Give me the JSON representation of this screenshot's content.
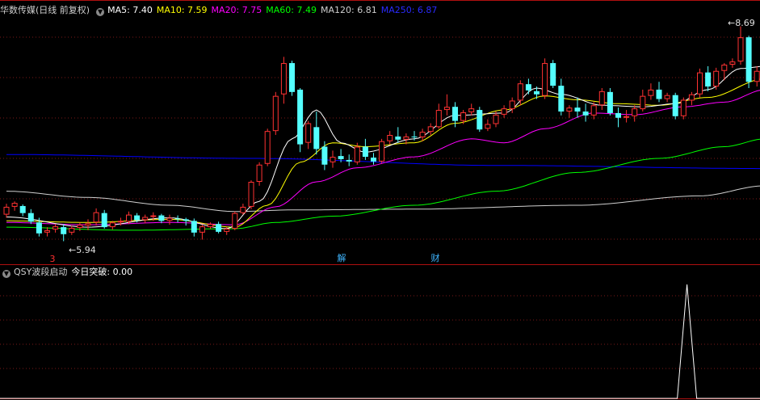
{
  "main_panel": {
    "title": "华数传媒(日线 前复权)",
    "indicators": [
      {
        "label": "MA5:",
        "value": "7.40",
        "color": "#ffffff"
      },
      {
        "label": "MA10:",
        "value": "7.59",
        "color": "#ffff00"
      },
      {
        "label": "MA20:",
        "value": "7.75",
        "color": "#ff00ff"
      },
      {
        "label": "MA60:",
        "value": "7.49",
        "color": "#00ff00"
      },
      {
        "label": "MA120:",
        "value": "6.81",
        "color": "#cfcfcf"
      },
      {
        "label": "MA250:",
        "value": "6.87",
        "color": "#0000ff"
      }
    ],
    "high_label": "8.69",
    "low_label": "5.94",
    "event_markers": [
      {
        "text": "3",
        "color": "#ff3030",
        "icon": "exclamation-marker"
      },
      {
        "text": "解",
        "color": "#3fb5ff",
        "icon": "unlock-marker"
      },
      {
        "text": "财",
        "color": "#3fb5ff",
        "icon": "finance-marker"
      }
    ]
  },
  "sub_panel": {
    "title": "QSY波段启动",
    "label": "今日突破:",
    "value": "0.00",
    "color": "#ffffff"
  },
  "colors": {
    "background": "#000000",
    "up": "#ff3232",
    "down": "#54ffff",
    "grid": "#7a1818",
    "separator": "#b01010"
  },
  "chart_data": {
    "type": "candlestick",
    "series_count": 93,
    "y_range": [
      5.8,
      8.8
    ],
    "candles_ohlc": [
      [
        6.28,
        6.42,
        6.24,
        6.38
      ],
      [
        6.38,
        6.45,
        6.33,
        6.43
      ],
      [
        6.39,
        6.41,
        6.26,
        6.3
      ],
      [
        6.3,
        6.35,
        6.16,
        6.19
      ],
      [
        6.18,
        6.24,
        6.0,
        6.04
      ],
      [
        6.05,
        6.12,
        6.0,
        6.08
      ],
      [
        6.09,
        6.16,
        6.05,
        6.13
      ],
      [
        6.12,
        6.16,
        5.94,
        6.03
      ],
      [
        6.05,
        6.14,
        6.02,
        6.11
      ],
      [
        6.11,
        6.18,
        6.07,
        6.15
      ],
      [
        6.14,
        6.22,
        6.08,
        6.17
      ],
      [
        6.18,
        6.36,
        6.14,
        6.31
      ],
      [
        6.3,
        6.34,
        6.1,
        6.12
      ],
      [
        6.12,
        6.2,
        6.09,
        6.18
      ],
      [
        6.18,
        6.24,
        6.14,
        6.2
      ],
      [
        6.19,
        6.32,
        6.16,
        6.28
      ],
      [
        6.27,
        6.3,
        6.18,
        6.21
      ],
      [
        6.21,
        6.28,
        6.17,
        6.25
      ],
      [
        6.25,
        6.31,
        6.2,
        6.27
      ],
      [
        6.27,
        6.29,
        6.17,
        6.2
      ],
      [
        6.2,
        6.28,
        6.15,
        6.24
      ],
      [
        6.23,
        6.27,
        6.18,
        6.22
      ],
      [
        6.22,
        6.24,
        6.14,
        6.2
      ],
      [
        6.2,
        6.23,
        6.0,
        6.05
      ],
      [
        6.05,
        6.15,
        5.96,
        6.13
      ],
      [
        6.12,
        6.18,
        6.1,
        6.16
      ],
      [
        6.16,
        6.19,
        6.04,
        6.06
      ],
      [
        6.06,
        6.12,
        6.02,
        6.1
      ],
      [
        6.1,
        6.32,
        6.08,
        6.3
      ],
      [
        6.3,
        6.42,
        6.28,
        6.38
      ],
      [
        6.38,
        6.72,
        6.35,
        6.7
      ],
      [
        6.7,
        6.95,
        6.65,
        6.92
      ],
      [
        6.93,
        7.38,
        6.9,
        7.35
      ],
      [
        7.35,
        7.85,
        7.3,
        7.8
      ],
      [
        7.82,
        8.3,
        7.7,
        8.22
      ],
      [
        8.22,
        8.25,
        7.8,
        7.85
      ],
      [
        7.88,
        7.9,
        7.08,
        7.18
      ],
      [
        7.2,
        7.48,
        7.12,
        7.45
      ],
      [
        7.4,
        7.6,
        7.05,
        7.12
      ],
      [
        7.15,
        7.22,
        6.85,
        6.92
      ],
      [
        6.95,
        7.1,
        6.88,
        7.02
      ],
      [
        7.03,
        7.12,
        6.95,
        6.99
      ],
      [
        6.98,
        7.05,
        6.9,
        6.96
      ],
      [
        6.95,
        7.2,
        6.92,
        7.15
      ],
      [
        7.15,
        7.25,
        6.98,
        7.02
      ],
      [
        7.01,
        7.07,
        6.92,
        6.96
      ],
      [
        6.96,
        7.25,
        6.94,
        7.22
      ],
      [
        7.22,
        7.35,
        7.18,
        7.3
      ],
      [
        7.28,
        7.4,
        7.2,
        7.24
      ],
      [
        7.24,
        7.32,
        7.18,
        7.28
      ],
      [
        7.28,
        7.35,
        7.23,
        7.27
      ],
      [
        7.27,
        7.38,
        7.22,
        7.34
      ],
      [
        7.34,
        7.45,
        7.3,
        7.41
      ],
      [
        7.4,
        7.7,
        7.38,
        7.62
      ],
      [
        7.62,
        7.82,
        7.55,
        7.66
      ],
      [
        7.66,
        7.72,
        7.4,
        7.48
      ],
      [
        7.48,
        7.62,
        7.44,
        7.59
      ],
      [
        7.59,
        7.7,
        7.55,
        7.64
      ],
      [
        7.62,
        7.66,
        7.34,
        7.37
      ],
      [
        7.38,
        7.5,
        7.35,
        7.44
      ],
      [
        7.44,
        7.6,
        7.4,
        7.56
      ],
      [
        7.56,
        7.68,
        7.52,
        7.64
      ],
      [
        7.63,
        7.78,
        7.58,
        7.74
      ],
      [
        7.74,
        8.0,
        7.68,
        7.96
      ],
      [
        7.95,
        8.02,
        7.82,
        7.87
      ],
      [
        7.86,
        7.92,
        7.76,
        7.82
      ],
      [
        7.8,
        8.28,
        7.76,
        8.22
      ],
      [
        8.22,
        8.26,
        7.9,
        7.93
      ],
      [
        7.93,
        8.02,
        7.55,
        7.6
      ],
      [
        7.6,
        7.68,
        7.52,
        7.65
      ],
      [
        7.65,
        7.78,
        7.52,
        7.6
      ],
      [
        7.6,
        7.7,
        7.47,
        7.55
      ],
      [
        7.55,
        7.72,
        7.5,
        7.68
      ],
      [
        7.68,
        7.9,
        7.62,
        7.86
      ],
      [
        7.85,
        7.9,
        7.55,
        7.58
      ],
      [
        7.58,
        7.65,
        7.4,
        7.52
      ],
      [
        7.52,
        7.62,
        7.46,
        7.54
      ],
      [
        7.54,
        7.68,
        7.47,
        7.64
      ],
      [
        7.63,
        7.88,
        7.6,
        7.8
      ],
      [
        7.8,
        7.96,
        7.75,
        7.88
      ],
      [
        7.88,
        7.98,
        7.72,
        7.76
      ],
      [
        7.76,
        7.84,
        7.72,
        7.81
      ],
      [
        7.81,
        7.84,
        7.5,
        7.54
      ],
      [
        7.54,
        7.78,
        7.5,
        7.75
      ],
      [
        7.74,
        7.85,
        7.68,
        7.82
      ],
      [
        7.82,
        8.15,
        7.78,
        8.1
      ],
      [
        8.1,
        8.18,
        7.86,
        7.92
      ],
      [
        7.92,
        8.16,
        7.88,
        8.12
      ],
      [
        8.12,
        8.22,
        8.0,
        8.2
      ],
      [
        8.2,
        8.28,
        8.16,
        8.24
      ],
      [
        8.24,
        8.69,
        8.2,
        8.55
      ],
      [
        8.55,
        8.57,
        7.9,
        7.98
      ],
      [
        7.98,
        8.18,
        7.92,
        8.12
      ]
    ],
    "ma_lines": [
      {
        "name": "MA250",
        "color": "#0000ff",
        "points": [
          [
            0,
            7.05
          ],
          [
            30,
            7.0
          ],
          [
            60,
            6.91
          ],
          [
            93,
            6.87
          ]
        ]
      },
      {
        "name": "MA120",
        "color": "#cfcfcf",
        "points": [
          [
            0,
            6.58
          ],
          [
            10,
            6.5
          ],
          [
            20,
            6.4
          ],
          [
            28,
            6.32
          ],
          [
            35,
            6.34
          ],
          [
            50,
            6.35
          ],
          [
            70,
            6.4
          ],
          [
            85,
            6.52
          ],
          [
            93,
            6.65
          ]
        ]
      },
      {
        "name": "MA60",
        "color": "#00ff00",
        "points": [
          [
            0,
            6.12
          ],
          [
            15,
            6.08
          ],
          [
            28,
            6.1
          ],
          [
            33,
            6.18
          ],
          [
            40,
            6.26
          ],
          [
            50,
            6.4
          ],
          [
            60,
            6.58
          ],
          [
            70,
            6.82
          ],
          [
            80,
            7.0
          ],
          [
            88,
            7.15
          ],
          [
            93,
            7.25
          ]
        ]
      },
      {
        "name": "MA20",
        "color": "#ff00ff",
        "points": [
          [
            0,
            6.18
          ],
          [
            10,
            6.15
          ],
          [
            20,
            6.18
          ],
          [
            28,
            6.15
          ],
          [
            33,
            6.38
          ],
          [
            38,
            6.7
          ],
          [
            43,
            6.88
          ],
          [
            50,
            7.02
          ],
          [
            57,
            7.25
          ],
          [
            61,
            7.2
          ],
          [
            66,
            7.38
          ],
          [
            72,
            7.58
          ],
          [
            77,
            7.56
          ],
          [
            83,
            7.66
          ],
          [
            88,
            7.72
          ],
          [
            93,
            7.88
          ]
        ]
      },
      {
        "name": "MA10",
        "color": "#ffff00",
        "points": [
          [
            0,
            6.2
          ],
          [
            10,
            6.18
          ],
          [
            20,
            6.22
          ],
          [
            28,
            6.12
          ],
          [
            32,
            6.4
          ],
          [
            36,
            6.95
          ],
          [
            40,
            7.2
          ],
          [
            44,
            7.15
          ],
          [
            50,
            7.2
          ],
          [
            55,
            7.45
          ],
          [
            61,
            7.62
          ],
          [
            66,
            7.8
          ],
          [
            70,
            7.75
          ],
          [
            75,
            7.7
          ],
          [
            80,
            7.68
          ],
          [
            86,
            7.78
          ],
          [
            93,
            8.02
          ]
        ]
      },
      {
        "name": "MA5",
        "color": "#ffffff",
        "points": [
          [
            0,
            6.25
          ],
          [
            10,
            6.12
          ],
          [
            20,
            6.24
          ],
          [
            27,
            6.1
          ],
          [
            31,
            6.45
          ],
          [
            35,
            7.25
          ],
          [
            38,
            7.62
          ],
          [
            41,
            7.2
          ],
          [
            44,
            7.08
          ],
          [
            50,
            7.25
          ],
          [
            55,
            7.55
          ],
          [
            61,
            7.58
          ],
          [
            65,
            7.9
          ],
          [
            68,
            7.82
          ],
          [
            73,
            7.68
          ],
          [
            78,
            7.66
          ],
          [
            82,
            7.7
          ],
          [
            86,
            7.88
          ],
          [
            90,
            8.15
          ],
          [
            93,
            8.18
          ]
        ]
      }
    ],
    "sub_series": {
      "name": "今日突破",
      "values_index_nonzero": [
        [
          86,
          1.0
        ]
      ],
      "y_range": [
        0,
        1.05
      ]
    }
  }
}
